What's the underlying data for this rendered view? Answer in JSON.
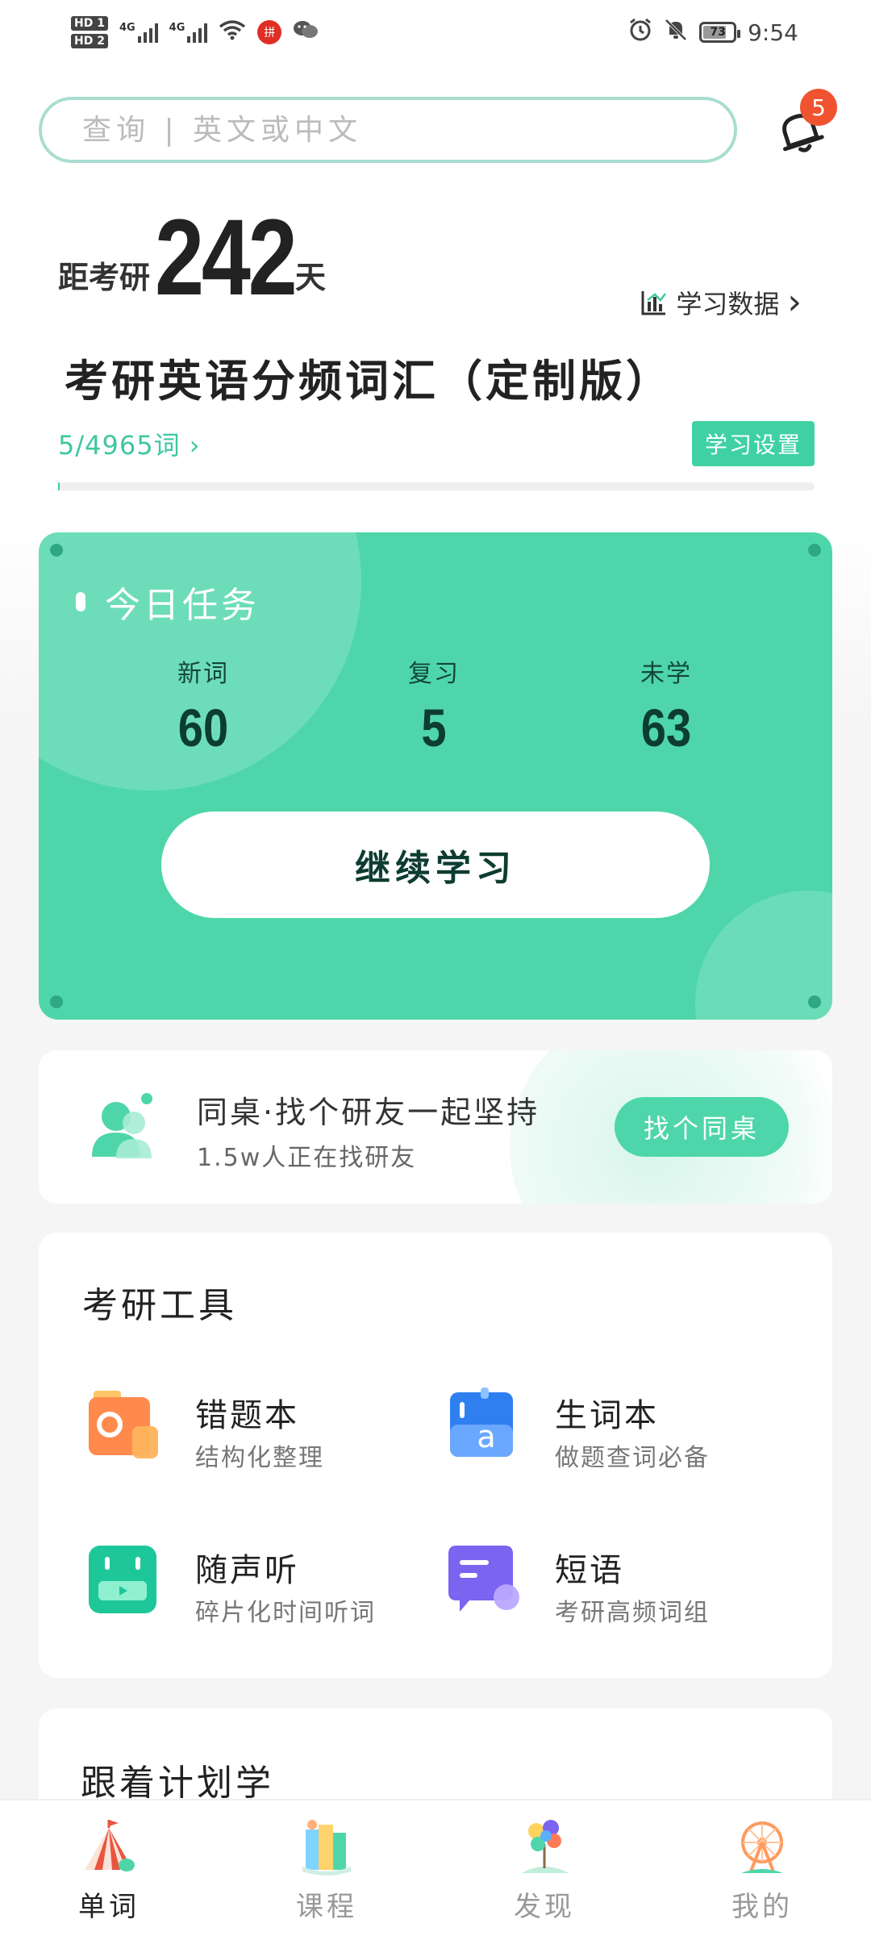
{
  "status_bar": {
    "sim1": "HD 1",
    "sim2": "HD 2",
    "net1": "4G",
    "net2": "4G",
    "notif_badge": "拼",
    "battery": "73",
    "time": "9:54"
  },
  "search": {
    "placeholder": "查询 | 英文或中文"
  },
  "notifications": {
    "count": "5"
  },
  "countdown": {
    "prefix": "距考研",
    "days": "242",
    "suffix": "天"
  },
  "study_data": {
    "label": "学习数据",
    "chevron": "›"
  },
  "book": {
    "title": "考研英语分频词汇（定制版）",
    "progress": "5/4965词 ›",
    "progress_fraction": 0.001,
    "settings_label": "学习设置"
  },
  "today_task": {
    "title": "今日任务",
    "stats": [
      {
        "label": "新词",
        "value": "60"
      },
      {
        "label": "复习",
        "value": "5"
      },
      {
        "label": "未学",
        "value": "63"
      }
    ],
    "continue_label": "继续学习"
  },
  "deskmate": {
    "title": "同桌·找个研友一起坚持",
    "subtitle": "1.5w人正在找研友",
    "button": "找个同桌"
  },
  "tools": {
    "title": "考研工具",
    "items": [
      {
        "name": "错题本",
        "desc": "结构化整理"
      },
      {
        "name": "生词本",
        "desc": "做题查词必备"
      },
      {
        "name": "随声听",
        "desc": "碎片化时间听词"
      },
      {
        "name": "短语",
        "desc": "考研高频词组"
      }
    ]
  },
  "plan": {
    "title": "跟着计划学"
  },
  "bottom_nav": {
    "items": [
      {
        "label": "单词",
        "icon": "tent-icon"
      },
      {
        "label": "课程",
        "icon": "books-icon"
      },
      {
        "label": "发现",
        "icon": "balloons-icon"
      },
      {
        "label": "我的",
        "icon": "ferris-wheel-icon"
      }
    ]
  },
  "colors": {
    "accent": "#4ed6aa",
    "accent_dark": "#0d3d31",
    "badge": "#f0532f"
  }
}
